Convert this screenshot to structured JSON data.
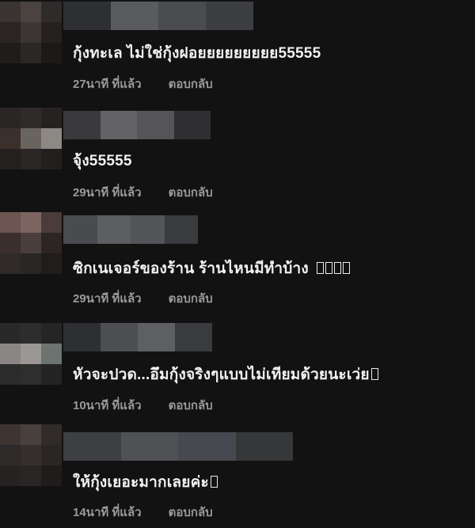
{
  "comments": [
    {
      "text": "กุ้งทะเล ไม่ใช่กุ้งฝอยยยยยยยยย55555",
      "time": "27นาที ที่แล้ว",
      "reply": "ตอบกลับ",
      "emoji_boxes": 0,
      "avatar_colors": [
        "#3a3533",
        "#4a4340",
        "#2e2b2a",
        "#2a2523",
        "#3b3634",
        "#242120",
        "#1f1c1b",
        "#2c2827",
        "#1c1a19"
      ],
      "name_colors": [
        "#2e2f33",
        "#5a5b5f",
        "#4b4c50",
        "#3d3e42"
      ]
    },
    {
      "text": "จุ้ง55555",
      "time": "29นาที ที่แล้ว",
      "reply": "ตอบกลับ",
      "emoji_boxes": 0,
      "avatar_colors": [
        "#2a2625",
        "#2f2b2a",
        "#252221",
        "#3b302b",
        "#6a645f",
        "#8c8884",
        "#24201f",
        "#2b2726",
        "#221f1e"
      ],
      "name_colors": [
        "#3a3a3d",
        "#636365",
        "#555558",
        "#2f2f32"
      ]
    },
    {
      "text": "ซิกเนเจอร์ของร้าน ร้านไหนมีทำบ้าง",
      "time": "29นาที ที่แล้ว",
      "reply": "ตอบกลับ",
      "emoji_boxes": 4,
      "avatar_colors": [
        "#6d5552",
        "#7e6461",
        "#4a3c3a",
        "#3b2f2e",
        "#4a3e3c",
        "#2c2524",
        "#2f2a29",
        "#2a2625",
        "#201d1c"
      ],
      "name_colors": [
        "#4a4b4e",
        "#5d5e61",
        "#535457",
        "#3a3b3e"
      ]
    },
    {
      "text": "หัวจะปวด...อึมกุ้งจริงๆแบบไม่เทียมด้วยนะเว่ย",
      "time": "10นาที ที่แล้ว",
      "reply": "ตอบกลับ",
      "emoji_boxes": 1,
      "avatar_colors": [
        "#2a2929",
        "#2e2d2d",
        "#262525",
        "#8a8685",
        "#9a9794",
        "#6b7470",
        "#2c2b2b",
        "#2f2e2e",
        "#252424"
      ],
      "name_colors": [
        "#2e2f33",
        "#4d4e52",
        "#5e5f62",
        "#3a3b3f"
      ]
    },
    {
      "text": "ให้กุ้งเยอะมากเลยค่ะ",
      "time": "14นาที ที่แล้ว",
      "reply": "ตอบกลับ",
      "emoji_boxes": 1,
      "avatar_colors": [
        "#3e3533",
        "#47403d",
        "#312c2a",
        "#2e2a29",
        "#35302e",
        "#2a2625",
        "#252221",
        "#292524",
        "#1f1c1b"
      ],
      "name_colors": [
        "#3e3f43",
        "#505155",
        "#474850",
        "#363739"
      ]
    }
  ]
}
